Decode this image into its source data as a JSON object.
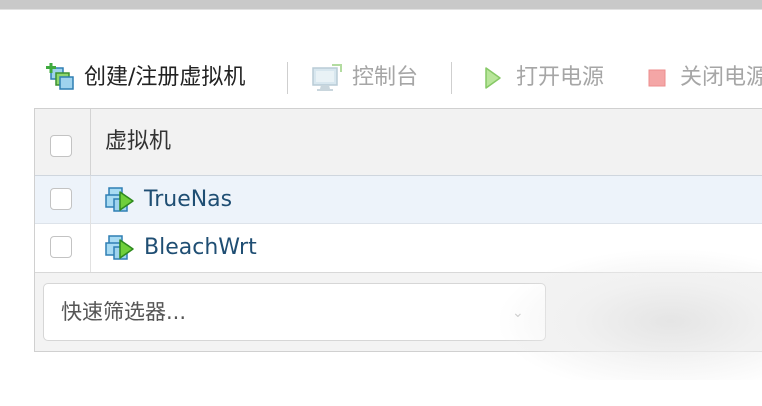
{
  "toolbar": {
    "create_register_vm": {
      "label": "创建/注册虚拟机",
      "icon": "create-vm-icon",
      "enabled": true
    },
    "console": {
      "label": "控制台",
      "icon": "console-monitor-icon",
      "enabled": false
    },
    "power_on": {
      "label": "打开电源",
      "icon": "play-icon",
      "enabled": false
    },
    "power_off": {
      "label": "关闭电源",
      "icon": "stop-square-icon",
      "enabled": false
    }
  },
  "table": {
    "columns": [
      {
        "label": "虚拟机"
      }
    ],
    "rows": [
      {
        "name": "TrueNas",
        "icon": "vm-running-icon",
        "selected": false
      },
      {
        "name": "BleachWrt",
        "icon": "vm-running-icon",
        "selected": false
      }
    ]
  },
  "filter": {
    "placeholder": "快速筛选器..."
  },
  "colors": {
    "link_text": "#1f4e73",
    "disabled_text": "#a6a6a6",
    "stop_icon": "#f08a8a",
    "play_icon": "#7ccf3f"
  }
}
